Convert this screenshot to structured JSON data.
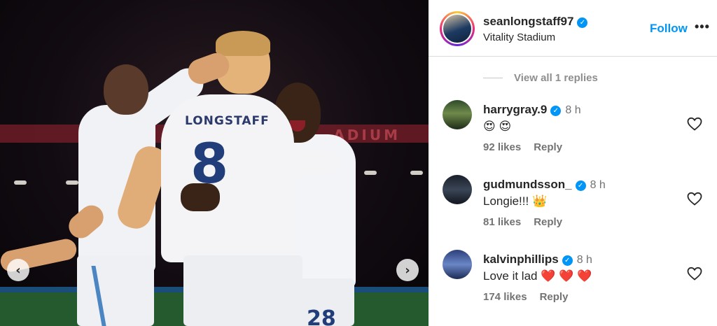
{
  "post": {
    "jersey_name": "LONGSTAFF",
    "jersey_number": "8",
    "second_number": "28",
    "stadium_banner": "ADIUM",
    "nav": {
      "prev_icon": "‹",
      "next_icon": "›"
    }
  },
  "header": {
    "username": "seanlongstaff97",
    "verified_icon": "✓",
    "location": "Vitality Stadium",
    "follow_label": "Follow",
    "more_icon": "•••"
  },
  "replies": {
    "view_all_label": "View all 1 replies"
  },
  "comments": [
    {
      "username": "harrygray.9",
      "verified_icon": "✓",
      "time": "8 h",
      "text": "😍 😍",
      "likes": "92 likes",
      "reply_label": "Reply"
    },
    {
      "username": "gudmundsson_",
      "verified_icon": "✓",
      "time": "8 h",
      "text": "Longie!!! 👑",
      "likes": "81 likes",
      "reply_label": "Reply"
    },
    {
      "username": "kalvinphillips",
      "verified_icon": "✓",
      "time": "8 h",
      "text": "Love it lad ❤️ ❤️ ❤️",
      "likes": "174 likes",
      "reply_label": "Reply"
    }
  ],
  "colors": {
    "accent": "#0095f6",
    "muted": "#737373",
    "text": "#262626"
  }
}
